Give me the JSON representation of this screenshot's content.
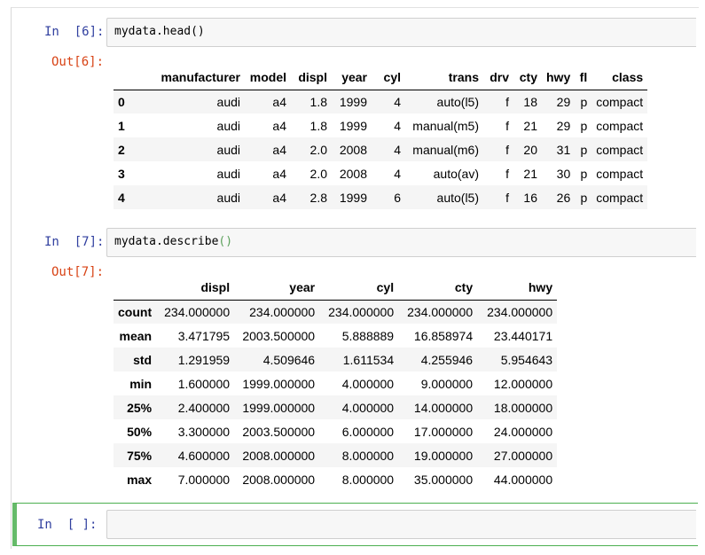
{
  "cells": [
    {
      "in_prompt": "In  [6]:",
      "code": "mydata.head()",
      "out_prompt": "Out[6]:",
      "columns": [
        "",
        "manufacturer",
        "model",
        "displ",
        "year",
        "cyl",
        "trans",
        "drv",
        "cty",
        "hwy",
        "fl",
        "class"
      ],
      "rows": [
        [
          "0",
          "audi",
          "a4",
          "1.8",
          "1999",
          "4",
          "auto(l5)",
          "f",
          "18",
          "29",
          "p",
          "compact"
        ],
        [
          "1",
          "audi",
          "a4",
          "1.8",
          "1999",
          "4",
          "manual(m5)",
          "f",
          "21",
          "29",
          "p",
          "compact"
        ],
        [
          "2",
          "audi",
          "a4",
          "2.0",
          "2008",
          "4",
          "manual(m6)",
          "f",
          "20",
          "31",
          "p",
          "compact"
        ],
        [
          "3",
          "audi",
          "a4",
          "2.0",
          "2008",
          "4",
          "auto(av)",
          "f",
          "21",
          "30",
          "p",
          "compact"
        ],
        [
          "4",
          "audi",
          "a4",
          "2.8",
          "1999",
          "6",
          "auto(l5)",
          "f",
          "16",
          "26",
          "p",
          "compact"
        ]
      ]
    },
    {
      "in_prompt": "In  [7]:",
      "code_name": "mydata.describe",
      "code_parens": "()",
      "out_prompt": "Out[7]:",
      "columns": [
        "",
        "displ",
        "year",
        "cyl",
        "cty",
        "hwy"
      ],
      "rows": [
        [
          "count",
          "234.000000",
          "234.000000",
          "234.000000",
          "234.000000",
          "234.000000"
        ],
        [
          "mean",
          "3.471795",
          "2003.500000",
          "5.888889",
          "16.858974",
          "23.440171"
        ],
        [
          "std",
          "1.291959",
          "4.509646",
          "1.611534",
          "4.255946",
          "5.954643"
        ],
        [
          "min",
          "1.600000",
          "1999.000000",
          "4.000000",
          "9.000000",
          "12.000000"
        ],
        [
          "25%",
          "2.400000",
          "1999.000000",
          "4.000000",
          "14.000000",
          "18.000000"
        ],
        [
          "50%",
          "3.300000",
          "2003.500000",
          "6.000000",
          "17.000000",
          "24.000000"
        ],
        [
          "75%",
          "4.600000",
          "2008.000000",
          "8.000000",
          "19.000000",
          "27.000000"
        ],
        [
          "max",
          "7.000000",
          "2008.000000",
          "8.000000",
          "35.000000",
          "44.000000"
        ]
      ]
    },
    {
      "in_prompt": "In  [ ]:",
      "code": ""
    }
  ],
  "colors": {
    "in_prompt": "#303f9f",
    "out_prompt": "#d84315",
    "selected_cell_border": "#66bb6a",
    "input_background": "#f7f7f7"
  }
}
